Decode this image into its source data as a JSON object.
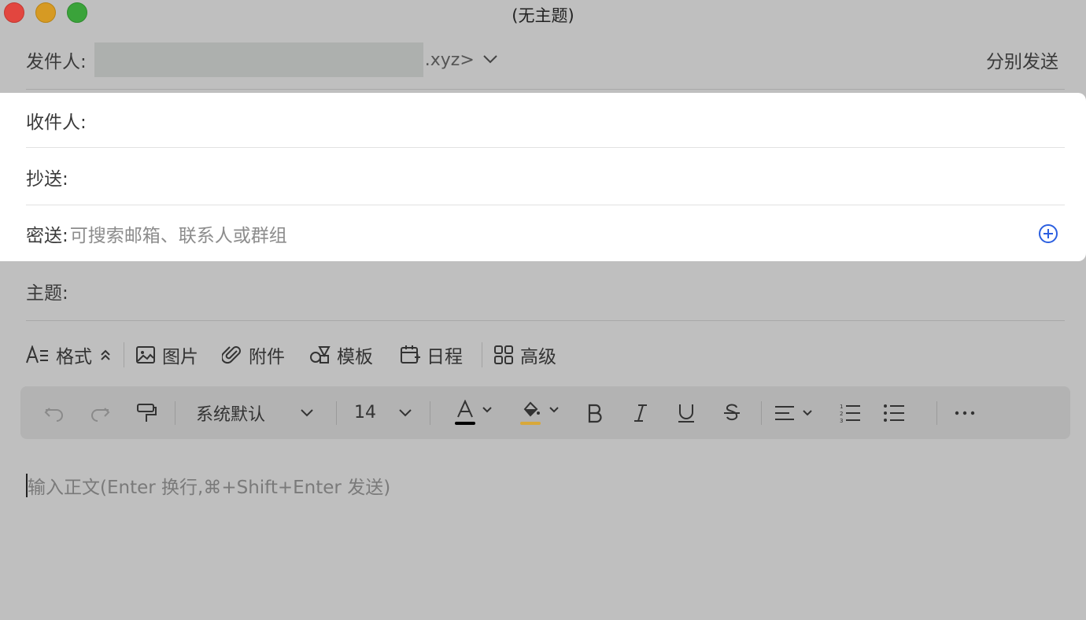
{
  "window": {
    "title": "(无主题)"
  },
  "from": {
    "label": "发件人:",
    "domain_suffix": ".xyz>",
    "send_separately": "分别发送"
  },
  "recipients": {
    "to_label": "收件人:",
    "cc_label": "抄送:",
    "bcc_label": "密送:",
    "bcc_placeholder": "可搜索邮箱、联系人或群组"
  },
  "subject": {
    "label": "主题:"
  },
  "toolbar": {
    "format": "格式",
    "image": "图片",
    "attachment": "附件",
    "template": "模板",
    "schedule": "日程",
    "advanced": "高级"
  },
  "format_bar": {
    "font_family": "系统默认",
    "font_size": "14",
    "text_color": "#000000",
    "highlight_color": "#d8a83a"
  },
  "body": {
    "placeholder": "输入正文(Enter 换行,⌘+Shift+Enter 发送)"
  },
  "colors": {
    "accent": "#2b5fe0",
    "card": "#ffffff",
    "overlay": "#bfbfbf"
  }
}
